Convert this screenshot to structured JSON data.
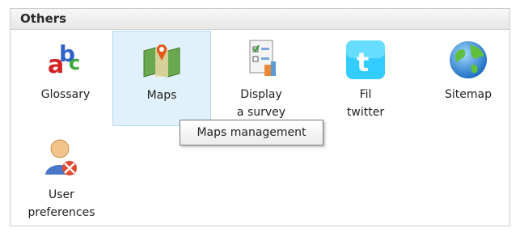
{
  "panel": {
    "title": "Others"
  },
  "items": [
    {
      "label": "Glossary",
      "icon": "glossary-icon"
    },
    {
      "label": "Maps",
      "icon": "maps-icon"
    },
    {
      "label_line1": "Display",
      "label_line2": "a survey",
      "icon": "survey-icon"
    },
    {
      "label_line1": "Fil",
      "label_line2": "twitter",
      "icon": "twitter-icon"
    },
    {
      "label": "Sitemap",
      "icon": "globe-icon"
    },
    {
      "label_line1": "User",
      "label_line2": "preferences",
      "icon": "user-preferences-icon"
    }
  ],
  "tooltip": {
    "text": "Maps management"
  },
  "colors": {
    "hover_bg": "#e1f1fb",
    "hover_border": "#b6dcf2",
    "twitter": "#33ccff"
  }
}
